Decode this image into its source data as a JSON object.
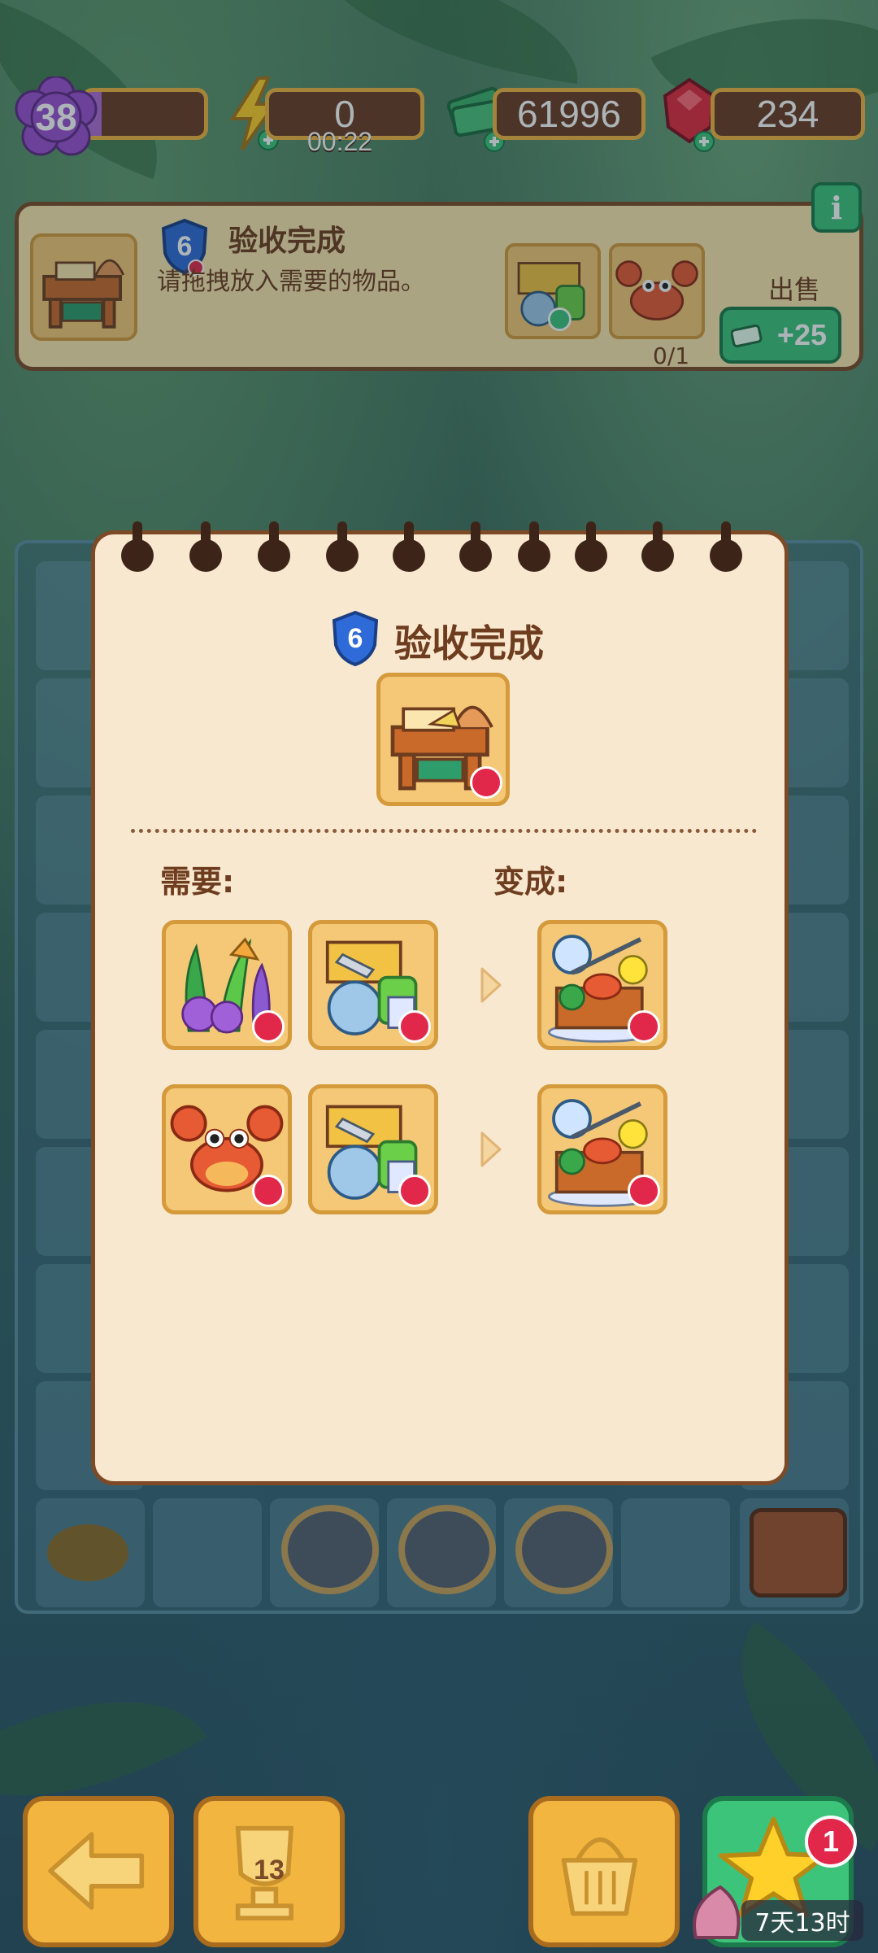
{
  "hud": {
    "level": "38",
    "xp_fraction": 0.14,
    "energy": "0",
    "energy_timer": "00:22",
    "cash": "61996",
    "gems": "234"
  },
  "order": {
    "level": "6",
    "title": "验收完成",
    "subtitle": "请拖拽放入需要的物品。",
    "progress": "0/1",
    "sell_label": "出售",
    "sell_reward": "+25",
    "info": "i"
  },
  "modal": {
    "level": "6",
    "title": "验收完成",
    "need_label": "需要:",
    "become_label": "变成:",
    "recipes": [
      {
        "inputs": [
          "coral-plants-tile",
          "fishing-supplies-tile"
        ],
        "output": "fishing-stand-tile"
      },
      {
        "inputs": [
          "crab-tile",
          "fishing-supplies-tile"
        ],
        "output": "fishing-stand-tile"
      }
    ]
  },
  "bottom_bar": {
    "trophy_count": "13",
    "notification_count": "1",
    "event_timer": "7天13时"
  },
  "colors": {
    "panel_bg": "#f8e8cf",
    "panel_border": "#7c4a27",
    "tile_bg": "#f4c877",
    "accent_green": "#3cc47b",
    "crown_red": "#e2284a",
    "text_brown": "#6e3c1e"
  }
}
